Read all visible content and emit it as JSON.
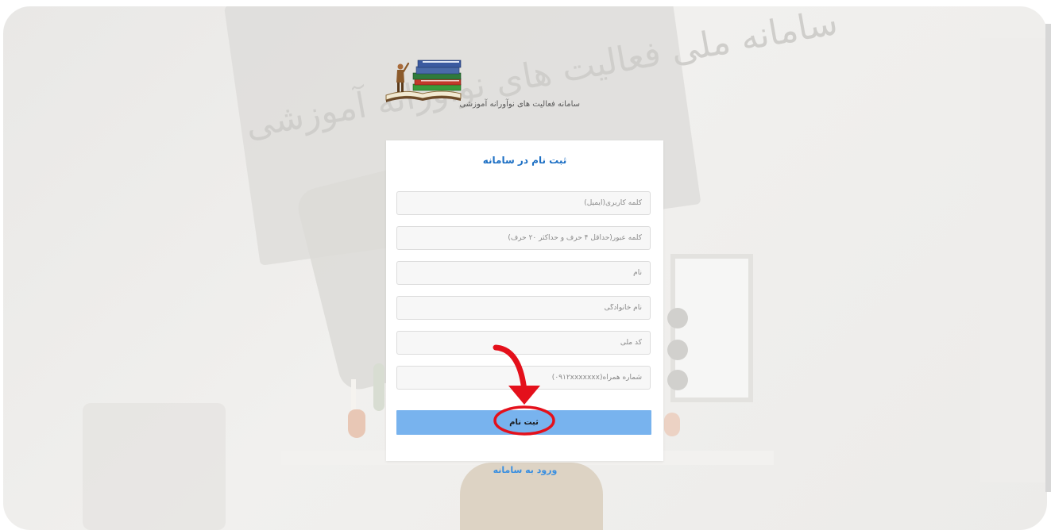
{
  "header": {
    "site_title": "سامانه فعالیت های نوآورانه آموزشی",
    "background_watermark": "سامانه ملی فعالیت های نوآورانه آموزشی"
  },
  "form": {
    "title": "ثبت نام در سامانه",
    "fields": {
      "username_placeholder": "کلمه کاربری(ایمیل)",
      "password_placeholder": "کلمه عبور(حداقل ۴ حرف و حداکثر ۲۰ حرف)",
      "first_name_placeholder": "نام",
      "last_name_placeholder": "نام خانوادگی",
      "national_code_placeholder": "کد ملی",
      "mobile_placeholder": "شماره همراه(۰۹۱۲xxxxxxx)"
    },
    "submit_label": "ثبت نام"
  },
  "login_link": "ورود به سامانه",
  "icons": {
    "logo": "books-teacher-logo-icon",
    "annotation_arrow": "red-arrow-icon",
    "annotation_circle": "red-circle-highlight-icon"
  },
  "colors": {
    "accent": "#1c6fc4",
    "button": "#78b3ee",
    "link": "#3a8fe0",
    "annotation": "#e4101b"
  }
}
